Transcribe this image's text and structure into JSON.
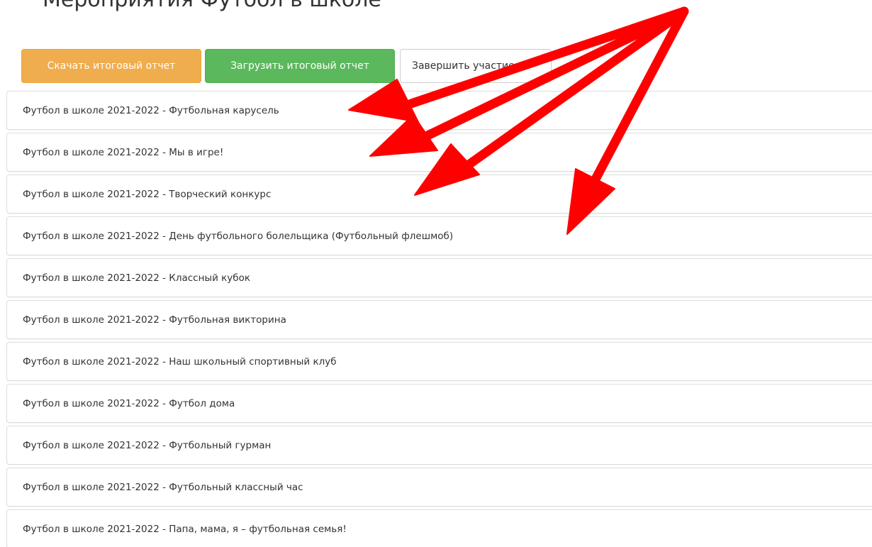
{
  "header": {
    "title": "Мероприятия Футбол в школе"
  },
  "toolbar": {
    "download_label": "Скачать итоговый отчет",
    "upload_label": "Загрузить итоговый отчет",
    "finish_label": "Завершить участие",
    "colors": {
      "download": "#f0ad4e",
      "upload": "#5cb85c",
      "finish": "#ffffff"
    }
  },
  "events": [
    "Футбол в школе 2021-2022 - Футбольная карусель",
    "Футбол в школе 2021-2022 - Мы в игре!",
    "Футбол в школе 2021-2022 - Творческий конкурс",
    "Футбол в школе 2021-2022 - День футбольного болельщика (Футбольный флешмоб)",
    "Футбол в школе 2021-2022 - Классный кубок",
    "Футбол в школе 2021-2022 - Футбольная викторина",
    "Футбол в школе 2021-2022 - Наш школьный спортивный клуб",
    "Футбол в школе 2021-2022 - Футбол дома",
    "Футбол в школе 2021-2022 - Футбольный гурман",
    "Футбол в школе 2021-2022 - Футбольный классный час",
    "Футбол в школе 2021-2022 - Папа, мама, я – футбольная семья!"
  ],
  "annotation": {
    "arrow_color": "#ff0000"
  }
}
